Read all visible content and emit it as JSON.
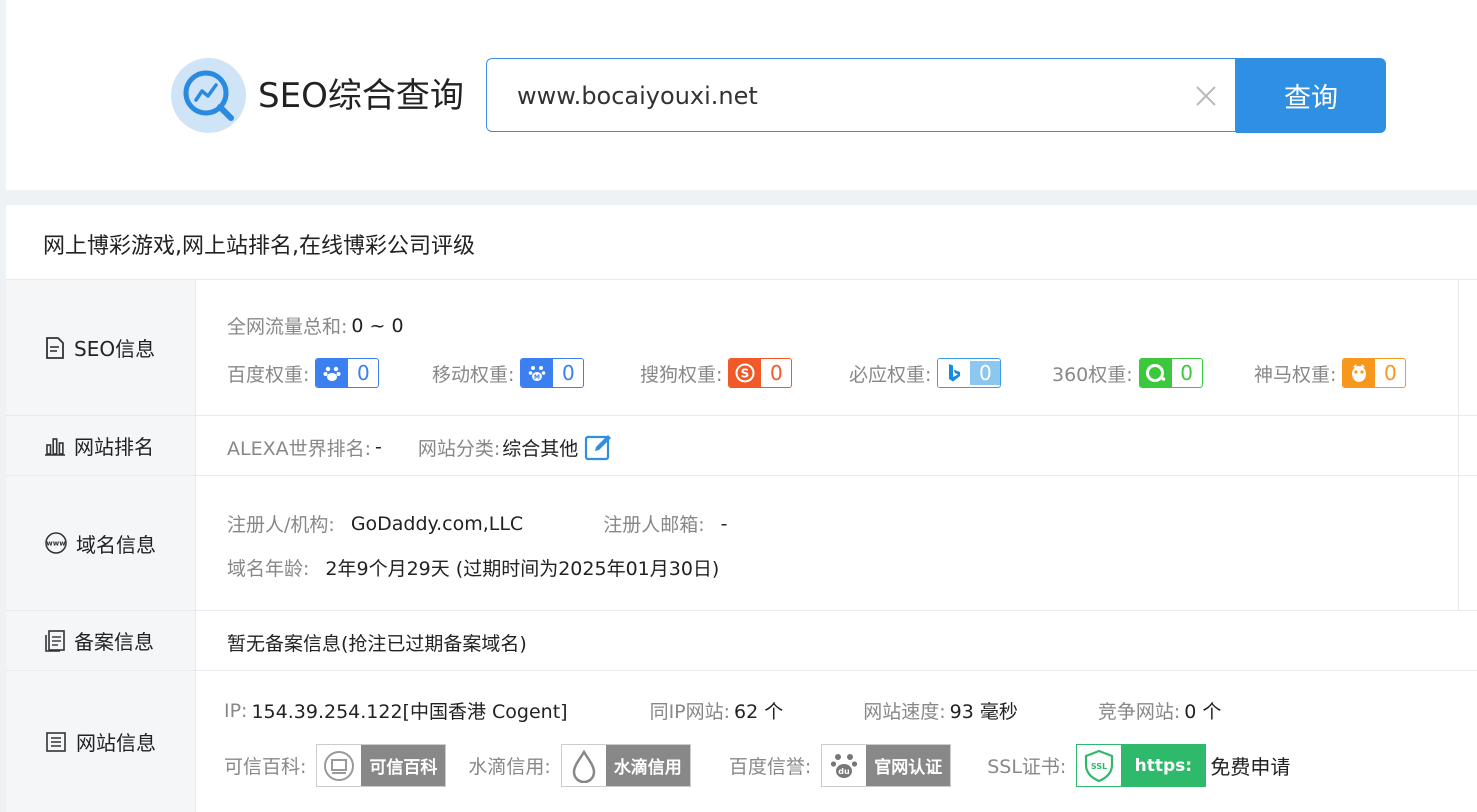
{
  "search": {
    "brand_title": "SEO综合查询",
    "query_value": "www.bocaiyouxi.net",
    "button_label": "查询"
  },
  "result": {
    "site_title": "网上博彩游戏,网上站排名,在线博彩公司评级",
    "seo": {
      "label": "SEO信息",
      "traffic_label": "全网流量总和:",
      "traffic_value": "0 ~ 0",
      "weights": [
        {
          "label": "百度权重:",
          "value": "0",
          "icon": "baidu-paw-icon",
          "color": "#3c7ff0"
        },
        {
          "label": "移动权重:",
          "value": "0",
          "icon": "baidu-mobile-icon",
          "color": "#3c7ff0"
        },
        {
          "label": "搜狗权重:",
          "value": "0",
          "icon": "sogou-icon",
          "color": "#f05a28"
        },
        {
          "label": "必应权重:",
          "value": "0",
          "icon": "bing-icon",
          "color": "#3b9de6"
        },
        {
          "label": "360权重:",
          "value": "0",
          "icon": "so360-icon",
          "color": "#3cc83c"
        },
        {
          "label": "神马权重:",
          "value": "0",
          "icon": "shenma-icon",
          "color": "#f7971d"
        }
      ]
    },
    "rank": {
      "label": "网站排名",
      "alexa_label": "ALEXA世界排名:",
      "alexa_value": "-",
      "category_label": "网站分类:",
      "category_value": "综合其他"
    },
    "domain": {
      "label": "域名信息",
      "registrant_label": "注册人/机构:",
      "registrant_value": "GoDaddy.com,LLC",
      "email_label": "注册人邮箱:",
      "email_value": "-",
      "age_label": "域名年龄:",
      "age_value": "2年9个月29天 (过期时间为2025年01月30日)"
    },
    "icp": {
      "label": "备案信息",
      "value": "暂无备案信息(抢注已过期备案域名)"
    },
    "site": {
      "label": "网站信息",
      "ip_label": "IP:",
      "ip_value": "154.39.254.122[中国香港 Cogent]",
      "same_ip_label": "同IP网站:",
      "same_ip_value": "62 个",
      "speed_label": "网站速度:",
      "speed_value": "93 毫秒",
      "competitors_label": "竞争网站:",
      "competitors_value": "0 个",
      "kexin_label": "可信百科:",
      "kexin_badge": "可信百科",
      "shuidi_label": "水滴信用:",
      "shuidi_badge": "水滴信用",
      "baidu_label": "百度信誉:",
      "baidu_badge": "官网认证",
      "ssl_label": "SSL证书:",
      "ssl_icon_text": "SSL",
      "ssl_badge": "https:",
      "ssl_apply": "免费申请"
    }
  }
}
